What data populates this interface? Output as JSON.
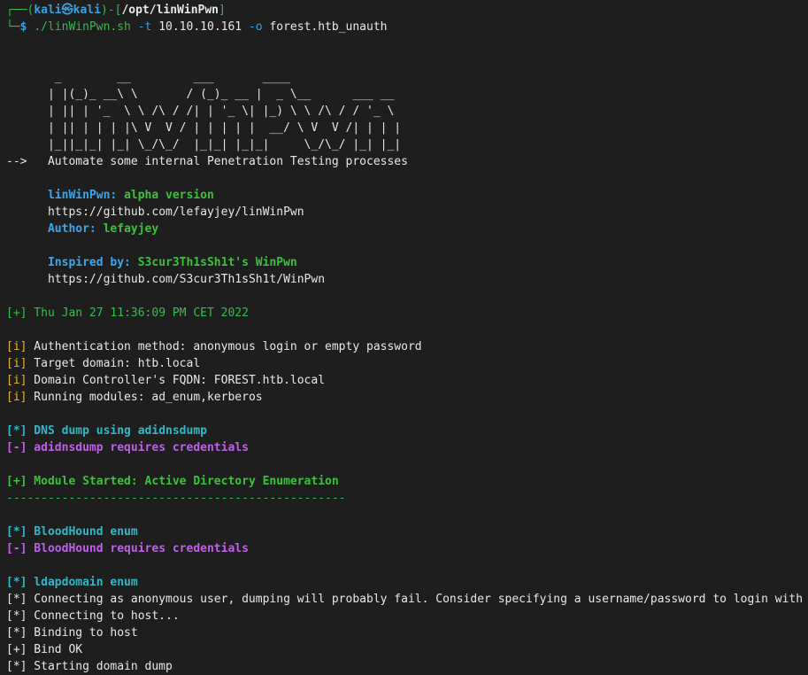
{
  "prompt": {
    "corner_top": "┌──(",
    "user": "kali",
    "at": "㉿",
    "host": "kali",
    "dir_sep": ")-[",
    "cwd": "/opt/linWinPwn",
    "close": "]",
    "corner_bottom": "└─",
    "dollar": "$ ",
    "cmd": "./linWinPwn.sh",
    "flag_t": " -t ",
    "target": "10.10.10.161",
    "flag_o": " -o ",
    "outdir": "forest.htb_unauth"
  },
  "banner": {
    "art": [
      "       _        __         ___       ____",
      "      | |(_)_ __\\ \\       / (_)_ __ |  _ \\__      ___ __",
      "      | || | '_  \\ \\ /\\ / /| | '_ \\| |_) \\ \\ /\\ / / '_ \\",
      "      | || | | | |\\ V  V / | | | | |  __/ \\ V  V /| | | |",
      "      |_||_|_| |_| \\_/\\_/  |_|_| |_|_|     \\_/\\_/ |_| |_|"
    ],
    "arrow": "-->   ",
    "tagline": "Automate some internal Penetration Testing processes",
    "version_label": "linWinPwn: ",
    "version_value": "alpha version",
    "repo_url": "https://github.com/lefayjey/linWinPwn",
    "author_label": "Author: ",
    "author_value": "lefayjey",
    "inspired_label": "Inspired by: ",
    "inspired_value": "S3cur3Th1sSh1t's WinPwn",
    "inspired_url": "https://github.com/S3cur3Th1sSh1t/WinPwn"
  },
  "output": {
    "timestamp_tag": "[+]",
    "timestamp": " Thu Jan 27 11:36:09 PM CET 2022",
    "info": [
      {
        "tag": "[i]",
        "text": " Authentication method: anonymous login or empty password"
      },
      {
        "tag": "[i]",
        "text": " Target domain: htb.local"
      },
      {
        "tag": "[i]",
        "text": " Domain Controller's FQDN: FOREST.htb.local"
      },
      {
        "tag": "[i]",
        "text": " Running modules: ad_enum,kerberos"
      }
    ],
    "dns_tag": "[*]",
    "dns_text": " DNS dump using adidnsdump",
    "dns_err_tag": "[-]",
    "dns_err_text": " adidnsdump requires credentials",
    "module_tag": "[+]",
    "module_text": " Module Started: Active Directory Enumeration",
    "separator": "-------------------------------------------------",
    "bh_tag": "[*]",
    "bh_text": " BloodHound enum",
    "bh_err_tag": "[-]",
    "bh_err_text": " BloodHound requires credentials",
    "ldap_tag": "[*]",
    "ldap_text": " ldapdomain enum",
    "ldap_lines": [
      "[*] Connecting as anonymous user, dumping will probably fail. Consider specifying a username/password to login with",
      "[*] Connecting to host...",
      "[*] Binding to host",
      "[+] Bind OK",
      "[*] Starting domain dump"
    ]
  },
  "colors": {
    "background": "#1e1e1e",
    "prompt_green": "#33b94c",
    "prompt_blue": "#3aa0dd",
    "tag_yellow": "#e5b527",
    "info_cyan": "#2fb8c8",
    "error_magenta": "#b552d8",
    "success_green": "#3cc13c"
  }
}
